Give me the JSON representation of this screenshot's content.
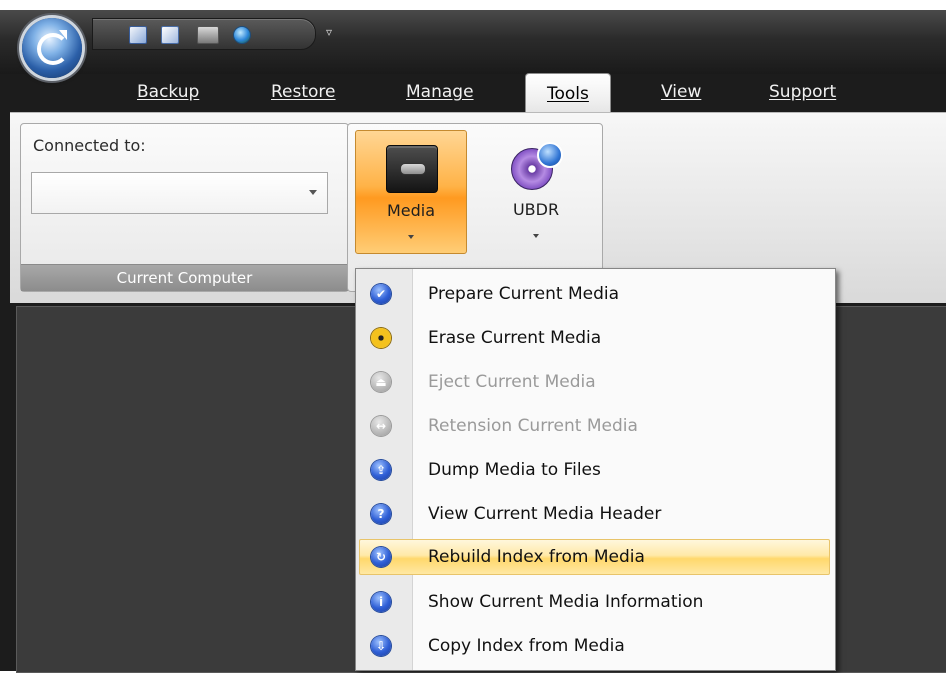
{
  "titlebar": {
    "quick_access_icons": [
      "backup-job-icon",
      "restore-job-icon",
      "devices-icon",
      "internet-icon"
    ],
    "quick_access_more": "▿"
  },
  "tabs": [
    {
      "label": "Backup",
      "active": false
    },
    {
      "label": "Restore",
      "active": false
    },
    {
      "label": "Manage",
      "active": false
    },
    {
      "label": "Tools",
      "active": true
    },
    {
      "label": "View",
      "active": false
    },
    {
      "label": "Support",
      "active": false
    }
  ],
  "ribbon": {
    "current_computer": {
      "connected_label": "Connected to:",
      "combo_value": "",
      "group_label": "Current Computer"
    },
    "media_button": {
      "label": "Media",
      "icon": "tape-media-icon"
    },
    "ubdr_button": {
      "label": "UBDR",
      "icon": "disc-restore-icon"
    }
  },
  "menu": {
    "items": [
      {
        "label": "Prepare Current Media",
        "icon": "checkmark-icon",
        "glyph": "✔",
        "enabled": true,
        "highlighted": false
      },
      {
        "label": "Erase Current Media",
        "icon": "radiation-icon",
        "glyph": "",
        "enabled": true,
        "highlighted": false
      },
      {
        "label": "Eject Current Media",
        "icon": "eject-icon",
        "glyph": "⏏",
        "enabled": false,
        "highlighted": false
      },
      {
        "label": "Retension Current Media",
        "icon": "retension-icon",
        "glyph": "↔",
        "enabled": false,
        "highlighted": false
      },
      {
        "label": "Dump Media to Files",
        "icon": "dump-files-icon",
        "glyph": "⇪",
        "enabled": true,
        "highlighted": false
      },
      {
        "label": "View Current Media Header",
        "icon": "help-icon",
        "glyph": "?",
        "enabled": true,
        "highlighted": false
      },
      {
        "label": "Rebuild Index from Media",
        "icon": "rebuild-icon",
        "glyph": "↻",
        "enabled": true,
        "highlighted": true
      },
      {
        "label": "Show Current Media Information",
        "icon": "info-icon",
        "glyph": "i",
        "enabled": true,
        "highlighted": false
      },
      {
        "label": "Copy Index from Media",
        "icon": "copy-down-icon",
        "glyph": "⇩",
        "enabled": true,
        "highlighted": false
      }
    ]
  }
}
